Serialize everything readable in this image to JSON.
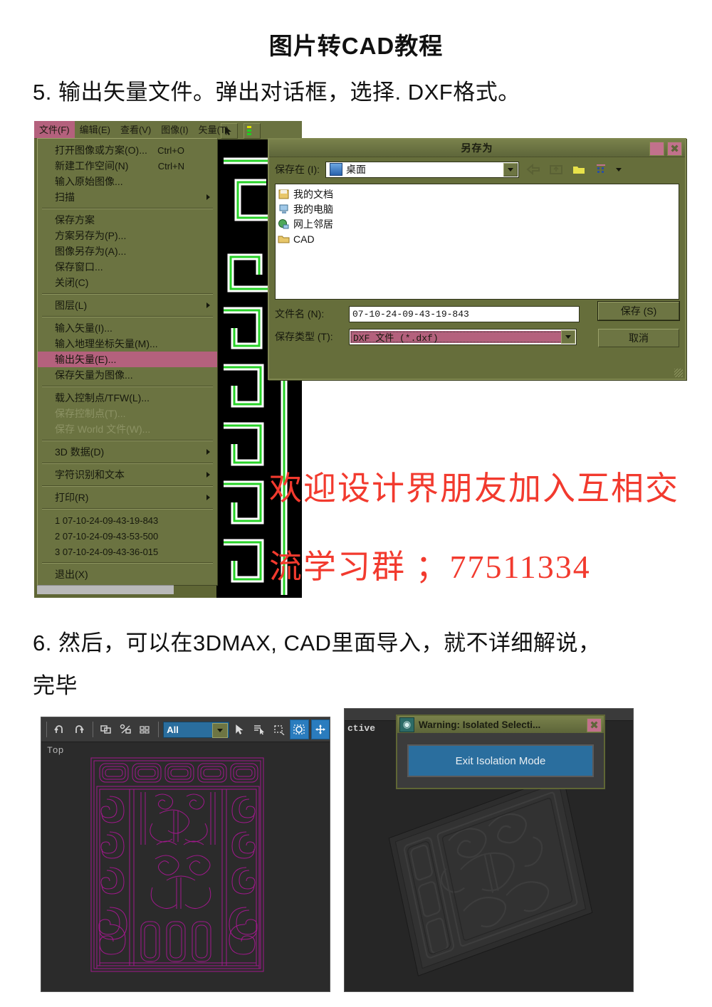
{
  "document": {
    "title": "图片转CAD教程",
    "step5": "5. 输出矢量文件。弹出对话框，选择. DXF格式。",
    "step6_line1": "6. 然后，可以在3DMAX, CAD里面导入，就不详细解说，",
    "step6_line2": "完毕",
    "promo_line1": "欢迎设计界朋友加入互相交",
    "promo_line2": "流学习群 ；77511334",
    "promo_color": "#f23a2e"
  },
  "vector_app": {
    "menubar": [
      {
        "label": "文件(F)",
        "selected": true
      },
      {
        "label": "编辑(E)",
        "selected": false
      },
      {
        "label": "查看(V)",
        "selected": false
      },
      {
        "label": "图像(I)",
        "selected": false
      },
      {
        "label": "矢量(T)",
        "selected": false
      }
    ],
    "file_menu": [
      {
        "label": "打开图像或方案(O)...",
        "accel": "Ctrl+O",
        "type": "item"
      },
      {
        "label": "新建工作空间(N)",
        "accel": "Ctrl+N",
        "type": "item"
      },
      {
        "label": "输入原始图像...",
        "accel": "",
        "type": "item"
      },
      {
        "label": "扫描",
        "accel": "",
        "type": "submenu"
      },
      {
        "type": "separator"
      },
      {
        "label": "保存方案",
        "accel": "",
        "type": "item"
      },
      {
        "label": "方案另存为(P)...",
        "accel": "",
        "type": "item"
      },
      {
        "label": "图像另存为(A)...",
        "accel": "",
        "type": "item"
      },
      {
        "label": "保存窗口...",
        "accel": "",
        "type": "item"
      },
      {
        "label": "关闭(C)",
        "accel": "",
        "type": "item"
      },
      {
        "type": "separator"
      },
      {
        "label": "图层(L)",
        "accel": "",
        "type": "submenu"
      },
      {
        "type": "separator"
      },
      {
        "label": "输入矢量(I)...",
        "accel": "",
        "type": "item"
      },
      {
        "label": "输入地理坐标矢量(M)...",
        "accel": "",
        "type": "item"
      },
      {
        "label": "输出矢量(E)...",
        "accel": "",
        "type": "highlighted"
      },
      {
        "label": "保存矢量为图像...",
        "accel": "",
        "type": "item"
      },
      {
        "type": "separator"
      },
      {
        "label": "载入控制点/TFW(L)...",
        "accel": "",
        "type": "item"
      },
      {
        "label": "保存控制点(T)...",
        "accel": "",
        "type": "disabled"
      },
      {
        "label": "保存 World 文件(W)...",
        "accel": "",
        "type": "disabled"
      },
      {
        "type": "separator"
      },
      {
        "label": "3D 数据(D)",
        "accel": "",
        "type": "submenu"
      },
      {
        "type": "separator"
      },
      {
        "label": "字符识别和文本",
        "accel": "",
        "type": "submenu"
      },
      {
        "type": "separator"
      },
      {
        "label": "打印(R)",
        "accel": "",
        "type": "submenu"
      },
      {
        "type": "separator"
      },
      {
        "label": "1 07-10-24-09-43-19-843",
        "accel": "",
        "type": "recent"
      },
      {
        "label": "2 07-10-24-09-43-53-500",
        "accel": "",
        "type": "recent"
      },
      {
        "label": "3 07-10-24-09-43-36-015",
        "accel": "",
        "type": "recent"
      },
      {
        "type": "separator"
      },
      {
        "label": "退出(X)",
        "accel": "",
        "type": "item"
      }
    ]
  },
  "save_dialog": {
    "title": "另存为",
    "save_in_label": "保存在 (I):",
    "save_in_value": "桌面",
    "places": [
      {
        "name": "我的文档",
        "icon": "documents-icon"
      },
      {
        "name": "我的电脑",
        "icon": "computer-icon"
      },
      {
        "name": "网上邻居",
        "icon": "network-icon"
      },
      {
        "name": "CAD",
        "icon": "folder-icon"
      }
    ],
    "filename_label": "文件名 (N):",
    "filename_value": "07-10-24-09-43-19-843",
    "filetype_label": "保存类型 (T):",
    "filetype_value": "DXF 文件 (*.dxf)",
    "save_button": "保存 (S)",
    "cancel_button": "取消",
    "toolbar_icons": [
      "back-icon",
      "up-one-level-icon",
      "new-folder-icon",
      "views-icon"
    ],
    "titlebar_buttons": [
      "restore-icon",
      "close-icon"
    ],
    "accent_selection": "#b4617d",
    "chrome_color": "#666e3b"
  },
  "max_window": {
    "toolbar_icons": [
      "undo-icon",
      "redo-icon",
      "select-link-icon",
      "unlink-icon",
      "bind-space-warp-icon",
      "select-object-icon",
      "select-by-name-icon",
      "select-region-icon",
      "window-crossing-icon",
      "select-and-move-icon"
    ],
    "selection_filter": "All",
    "viewport_label": "Top",
    "viewport_bg": "#2b2b2b",
    "vector_color": "#a1188c"
  },
  "render_window": {
    "active_label": "ctive",
    "dialog_title": "Warning: Isolated Selecti...",
    "dialog_button": "Exit Isolation Mode",
    "close_icon": "close-icon",
    "app_icon": "max-logo-icon",
    "background": "#262626"
  }
}
